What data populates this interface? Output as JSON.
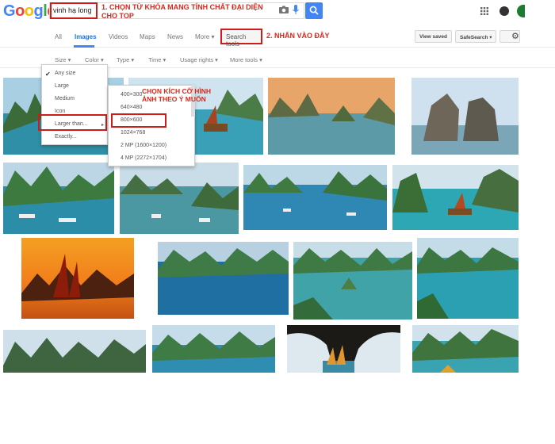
{
  "logo": {
    "letters": [
      "G",
      "o",
      "o",
      "g",
      "l",
      "e"
    ],
    "colors": [
      "#4285f4",
      "#ea4335",
      "#fbbc05",
      "#4285f4",
      "#34a853",
      "#ea4335"
    ]
  },
  "search": {
    "query": "vinh hạ long"
  },
  "annotations": {
    "step1": "1. CHỌN TỪ KHÓA MANG TÍNH CHẤT ĐẠI DIỆN CHO TOP",
    "step2": "2. NHẤN VÀO ĐÂY",
    "step3": "CHỌN KÍCH CỠ HÌNH ẢNH THEO Ý MUỐN"
  },
  "nav": {
    "tabs": [
      "All",
      "Images",
      "Videos",
      "Maps",
      "News",
      "More ▾"
    ],
    "search_tools": "Search tools",
    "view_saved": "View saved",
    "safesearch": "SafeSearch ▾"
  },
  "tools": [
    "Size ▾",
    "Color ▾",
    "Type ▾",
    "Time ▾",
    "Usage rights ▾",
    "More tools ▾"
  ],
  "size_menu": {
    "items": [
      "Any size",
      "Large",
      "Medium",
      "Icon",
      "Larger than...",
      "Exactly..."
    ],
    "chevron": "▸"
  },
  "larger_than_menu": {
    "items": [
      "400×300",
      "640×480",
      "800×600",
      "1024×768",
      "2 MP (1600×1200)",
      "4 MP (2272×1704)"
    ]
  },
  "colors": {
    "accent": "#4285f4",
    "annotation": "#d32a1e",
    "highlight_box": "#cc1c1c"
  }
}
